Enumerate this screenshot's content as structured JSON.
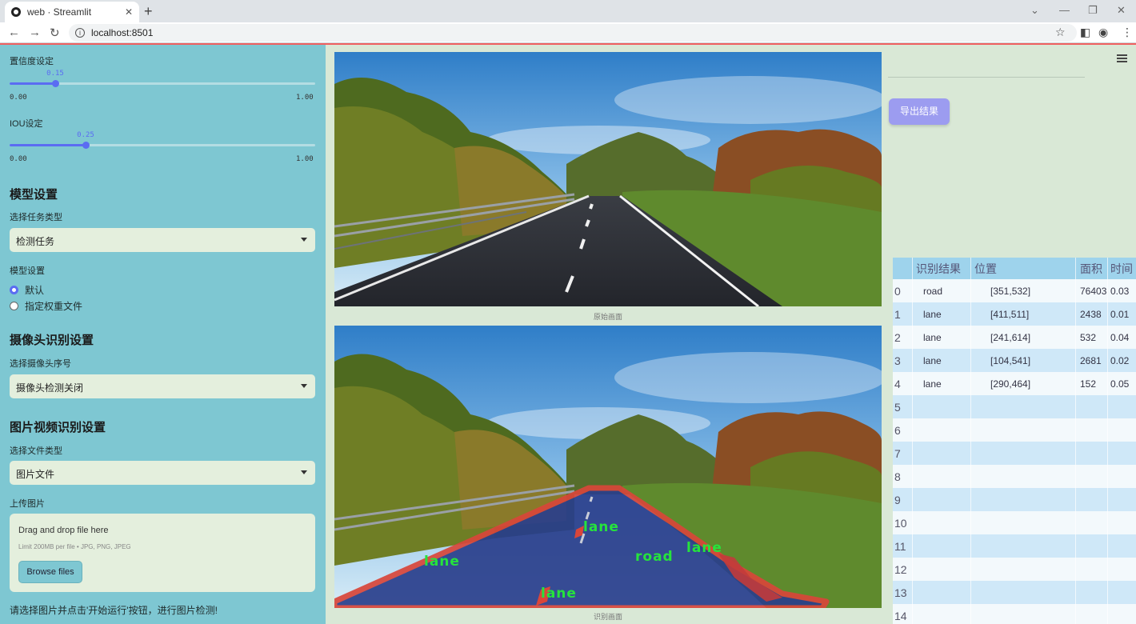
{
  "browser": {
    "tab_title": "web · Streamlit",
    "url": "localhost:8501"
  },
  "sidebar": {
    "confidence_label": "置信度设定",
    "confidence_value": "0.15",
    "confidence_min": "0.00",
    "confidence_max": "1.00",
    "confidence_level": 0.15,
    "iou_label": "IOU设定",
    "iou_value": "0.25",
    "iou_min": "0.00",
    "iou_max": "1.00",
    "iou_level": 0.25,
    "model_section": "模型设置",
    "task_label": "选择任务类型",
    "task_value": "检测任务",
    "model_label": "模型设置",
    "model_options": [
      "默认",
      "指定权重文件"
    ],
    "model_selected": "默认",
    "camera_section": "摄像头识别设置",
    "camera_label": "选择摄像头序号",
    "camera_value": "摄像头检测关闭",
    "media_section": "图片视频识别设置",
    "file_type_label": "选择文件类型",
    "file_type_value": "图片文件",
    "upload_label": "上传图片",
    "upload_title": "Drag and drop file here",
    "upload_limit": "Limit 200MB per file • JPG, PNG, JPEG",
    "browse_button": "Browse files",
    "footer_hint": "请选择图片并点击'开始运行'按钮，进行图片检测!"
  },
  "main": {
    "original_caption": "原始画面",
    "result_caption": "识别画面",
    "export_button": "导出结果",
    "detection_labels": [
      "lane",
      "lane",
      "road",
      "lane",
      "lane"
    ]
  },
  "table": {
    "headers": [
      "识别结果",
      "位置",
      "面积",
      "时间"
    ],
    "rows": [
      {
        "idx": "0",
        "name": "road",
        "pos": "[351,532]",
        "area": "76403",
        "time": "0.03"
      },
      {
        "idx": "1",
        "name": "lane",
        "pos": "[411,511]",
        "area": "2438",
        "time": "0.01"
      },
      {
        "idx": "2",
        "name": "lane",
        "pos": "[241,614]",
        "area": "532",
        "time": "0.04"
      },
      {
        "idx": "3",
        "name": "lane",
        "pos": "[104,541]",
        "area": "2681",
        "time": "0.02"
      },
      {
        "idx": "4",
        "name": "lane",
        "pos": "[290,464]",
        "area": "152",
        "time": "0.05"
      },
      {
        "idx": "5",
        "name": "",
        "pos": "",
        "area": "",
        "time": ""
      },
      {
        "idx": "6",
        "name": "",
        "pos": "",
        "area": "",
        "time": ""
      },
      {
        "idx": "7",
        "name": "",
        "pos": "",
        "area": "",
        "time": ""
      },
      {
        "idx": "8",
        "name": "",
        "pos": "",
        "area": "",
        "time": ""
      },
      {
        "idx": "9",
        "name": "",
        "pos": "",
        "area": "",
        "time": ""
      },
      {
        "idx": "10",
        "name": "",
        "pos": "",
        "area": "",
        "time": ""
      },
      {
        "idx": "11",
        "name": "",
        "pos": "",
        "area": "",
        "time": ""
      },
      {
        "idx": "12",
        "name": "",
        "pos": "",
        "area": "",
        "time": ""
      },
      {
        "idx": "13",
        "name": "",
        "pos": "",
        "area": "",
        "time": ""
      },
      {
        "idx": "14",
        "name": "",
        "pos": "",
        "area": "",
        "time": ""
      }
    ]
  },
  "colors": {
    "sidebar_bg": "#7ec7d2",
    "accent": "#5b6cf2",
    "export_button": "#9c9cf0",
    "mask_red": "#d9463a",
    "label_green": "#26e33c"
  }
}
